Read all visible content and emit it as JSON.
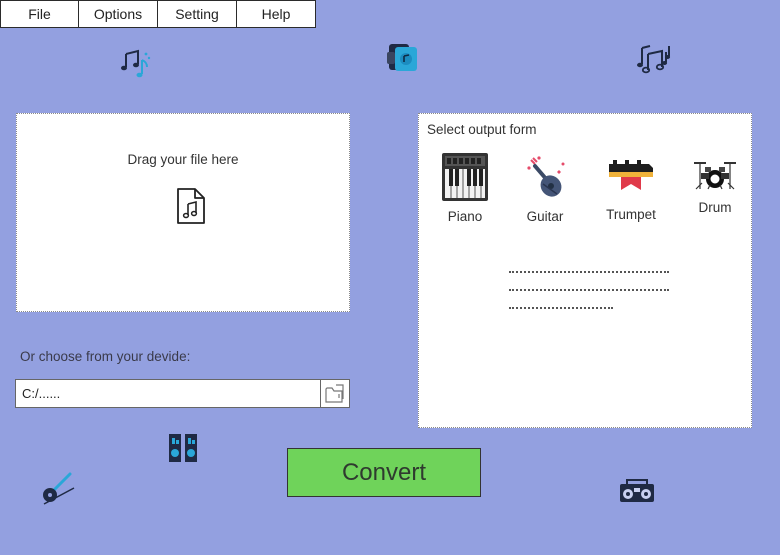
{
  "menu": {
    "file": "File",
    "options": "Options",
    "setting": "Setting",
    "help": "Help"
  },
  "dropzone": {
    "text": "Drag your file here",
    "icon": "audio-file-icon"
  },
  "device": {
    "label": "Or choose from your devide:",
    "path_value": "C:/......",
    "browse_icon": "folder-icon"
  },
  "output": {
    "title": "Select output form",
    "instruments": [
      {
        "label": "Piano",
        "icon": "piano-icon"
      },
      {
        "label": "Guitar",
        "icon": "guitar-icon"
      },
      {
        "label": "Trumpet",
        "icon": "trumpet-icon"
      },
      {
        "label": "Drum",
        "icon": "drum-kit-icon"
      }
    ]
  },
  "convert": {
    "label": "Convert"
  },
  "colors": {
    "background": "#93a0e0",
    "convert_button": "#6fd35a",
    "panel": "#ffffff"
  },
  "decorative_icons": [
    "music-notes-icon",
    "music-player-icon",
    "sheet-music-notes-icon",
    "speakers-icon",
    "guitar-small-icon",
    "boombox-icon"
  ]
}
